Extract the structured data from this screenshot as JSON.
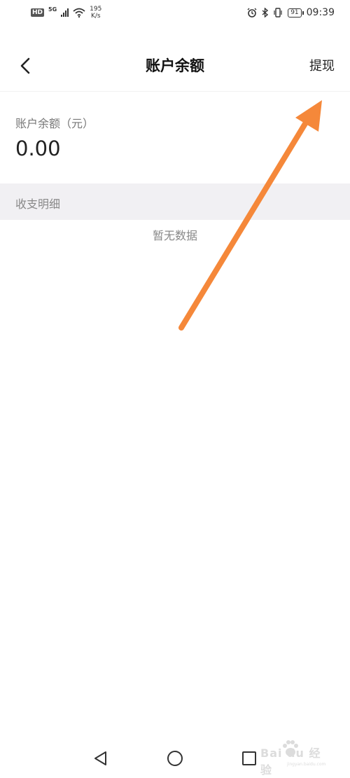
{
  "status_bar": {
    "hd_badge": "HD",
    "network_type": "5G",
    "speed_value": "195",
    "speed_unit": "K/s",
    "battery_level": "91",
    "time": "09:39"
  },
  "header": {
    "title": "账户余额",
    "withdraw_label": "提现",
    "back_icon": "chevron-left-icon"
  },
  "balance": {
    "label": "账户余额（元）",
    "value": "0.00"
  },
  "details": {
    "section_title": "收支明细",
    "empty_text": "暂无数据"
  },
  "annotation": {
    "arrow_color": "#f5883a"
  },
  "nav_bar": {
    "icons": [
      "back-triangle-icon",
      "home-circle-icon",
      "recents-square-icon"
    ]
  },
  "watermark": {
    "text": "Bai du 经验",
    "sub": "jingyan.baidu.com"
  },
  "colors": {
    "background": "#ffffff",
    "section_bg": "#f1f0f3",
    "secondary_text": "#888888",
    "primary_text": "#222222"
  }
}
